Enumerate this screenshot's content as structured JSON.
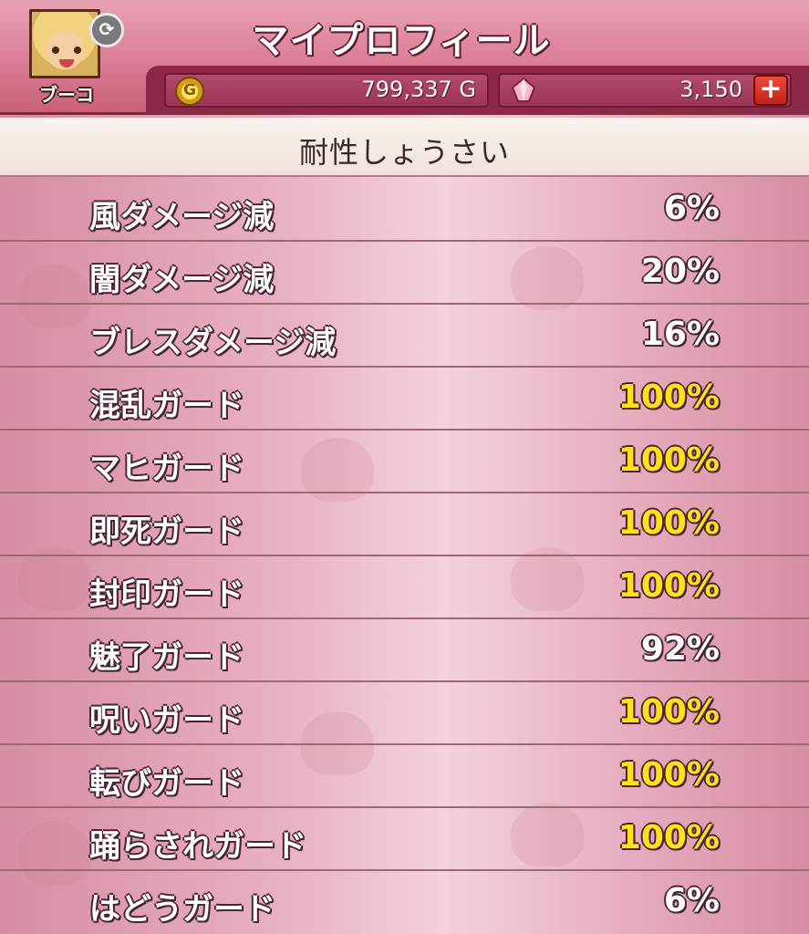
{
  "header": {
    "title": "マイプロフィール",
    "player_name": "ブーコ",
    "gold_value": "799,337 G",
    "gem_value": "3,150",
    "gold_icon": "gold-coin-icon",
    "gold_icon_glyph": "G",
    "gem_icon": "gem-icon",
    "plus_label": "+",
    "swap_glyph": "⟳"
  },
  "section": {
    "title": "耐性しょうさい"
  },
  "colors": {
    "header_bg": "#db7d96",
    "strip_bg": "#8d2846",
    "max_value": "#ffe01a",
    "normal_value": "#ffffff"
  },
  "resistances": [
    {
      "label": "風ダメージ減",
      "value": "6%",
      "max": false
    },
    {
      "label": "闇ダメージ減",
      "value": "20%",
      "max": false
    },
    {
      "label": "ブレスダメージ減",
      "value": "16%",
      "max": false
    },
    {
      "label": "混乱ガード",
      "value": "100%",
      "max": true
    },
    {
      "label": "マヒガード",
      "value": "100%",
      "max": true
    },
    {
      "label": "即死ガード",
      "value": "100%",
      "max": true
    },
    {
      "label": "封印ガード",
      "value": "100%",
      "max": true
    },
    {
      "label": "魅了ガード",
      "value": "92%",
      "max": false
    },
    {
      "label": "呪いガード",
      "value": "100%",
      "max": true
    },
    {
      "label": "転びガード",
      "value": "100%",
      "max": true
    },
    {
      "label": "踊らされガード",
      "value": "100%",
      "max": true
    },
    {
      "label": "はどうガード",
      "value": "6%",
      "max": false
    }
  ]
}
